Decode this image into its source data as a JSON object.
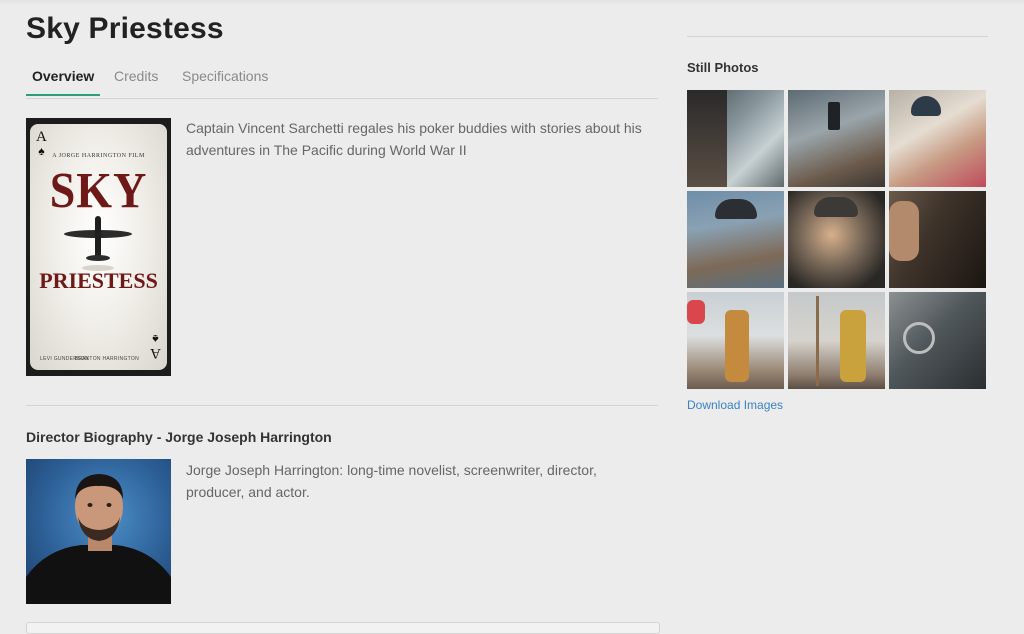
{
  "page": {
    "title": "Sky Priestess"
  },
  "tabs": [
    {
      "label": "Overview",
      "active": true
    },
    {
      "label": "Credits",
      "active": false
    },
    {
      "label": "Specifications",
      "active": false
    }
  ],
  "poster": {
    "tagline": "A JORGE HARRINGTON FILM",
    "title_line1": "SKY",
    "title_line2": "PRIESTESS",
    "card_rank": "A",
    "actor_left": "LEVI GUNDERSON",
    "actor_right": "BRAXTON HARRINGTON"
  },
  "synopsis": "Captain Vincent Sarchetti regales his poker buddies with stories about his adventures in The Pacific during World War II",
  "director": {
    "heading": "Director Biography - Jorge Joseph Harrington",
    "bio": "Jorge Joseph Harrington: long-time novelist, screenwriter, director, producer, and actor."
  },
  "stills": {
    "heading": "Still Photos",
    "download_label": "Download Images",
    "count": 9
  },
  "colors": {
    "accent": "#2e9e7a",
    "link": "#3a82c4",
    "poster_title": "#6e1818",
    "background": "#ececec"
  }
}
